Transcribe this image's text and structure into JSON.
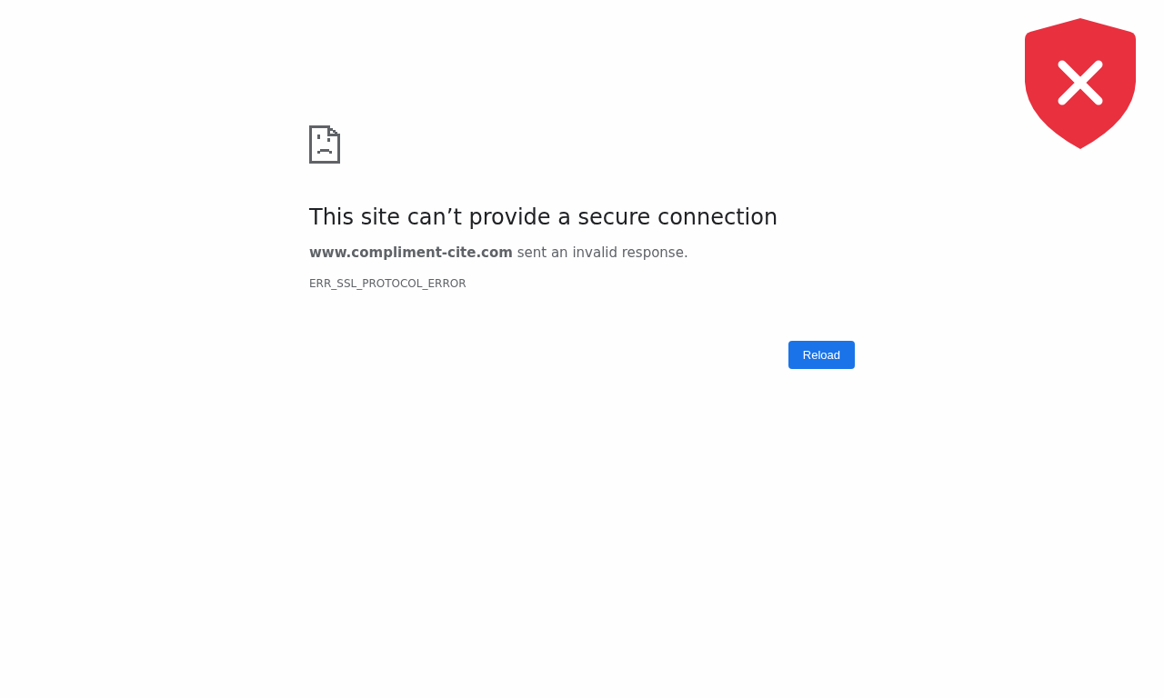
{
  "error_page": {
    "title": "This site can’t provide a secure connection",
    "message": "**www.compliment-cite.com** sent an invalid response.",
    "error_code": "ERR_SSL_PROTOCOL_ERROR",
    "buttons": [
      "Reload"
    ]
  }
}
